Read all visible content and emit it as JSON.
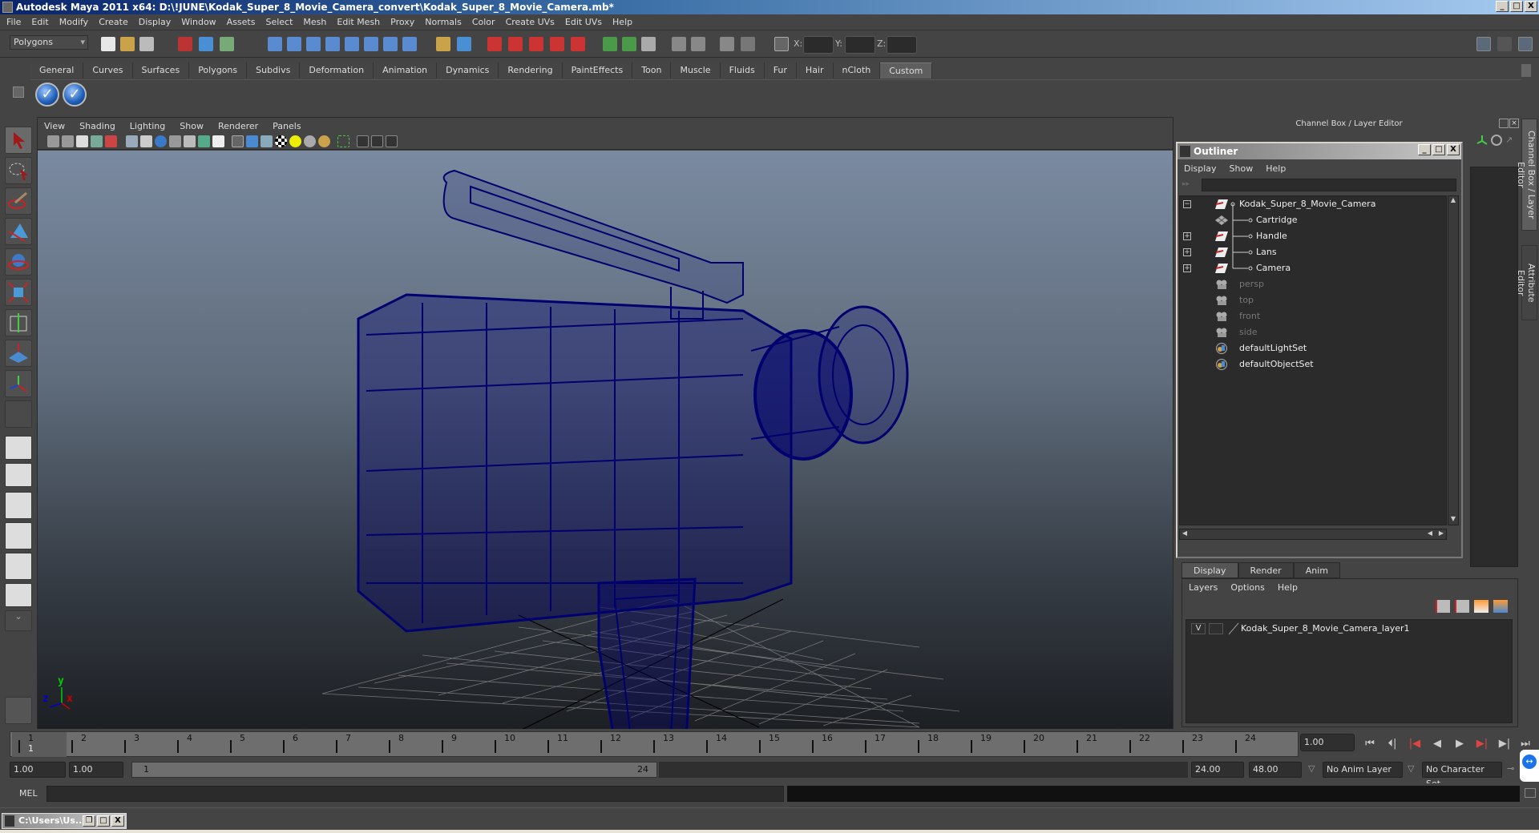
{
  "window": {
    "title": "Autodesk Maya 2011 x64: D:\\!JUNE\\Kodak_Super_8_Movie_Camera_convert\\Kodak_Super_8_Movie_Camera.mb*",
    "minimize": "_",
    "maximize": "□",
    "close": "X"
  },
  "menubar": [
    "File",
    "Edit",
    "Modify",
    "Create",
    "Display",
    "Window",
    "Assets",
    "Select",
    "Mesh",
    "Edit Mesh",
    "Proxy",
    "Normals",
    "Color",
    "Create UVs",
    "Edit UVs",
    "Help"
  ],
  "statusline": {
    "mode_selector": "Polygons",
    "x_label": "X:",
    "y_label": "Y:",
    "z_label": "Z:",
    "x_value": "",
    "y_value": "",
    "z_value": ""
  },
  "shelf": {
    "tabs": [
      "General",
      "Curves",
      "Surfaces",
      "Polygons",
      "Subdivs",
      "Deformation",
      "Animation",
      "Dynamics",
      "Rendering",
      "PaintEffects",
      "Toon",
      "Muscle",
      "Fluids",
      "Fur",
      "Hair",
      "nCloth",
      "Custom"
    ],
    "active_tab": "Custom",
    "buttons": [
      "checkmark-icon",
      "checkmark-icon"
    ]
  },
  "toolbox": [
    "select-tool",
    "lasso-tool",
    "paint-select-tool",
    "move-tool",
    "rotate-tool",
    "scale-tool",
    "universal-manipulator",
    "soft-mod-tool",
    "show-manipulator",
    "last-tool",
    "single-perspective-layout",
    "four-view-layout",
    "outliner-persp-layout",
    "persp-graph-layout",
    "hypershade-persp-layout",
    "persp-graph-outliner-layout",
    "layout-more",
    "maya-logo"
  ],
  "viewport": {
    "menu": [
      "View",
      "Shading",
      "Lighting",
      "Show",
      "Renderer",
      "Panels"
    ],
    "axis": {
      "x": "x",
      "y": "y",
      "z": "z"
    },
    "wireframe_color": "#00006e"
  },
  "channel_box": {
    "header": "Channel Box / Layer Editor"
  },
  "outliner": {
    "title": "Outliner",
    "menu": [
      "Display",
      "Show",
      "Help"
    ],
    "items": [
      {
        "label": "Kodak_Super_8_Movie_Camera",
        "expander": "−",
        "type": "transform",
        "child": false,
        "dim": false
      },
      {
        "label": "Cartridge",
        "expander": "",
        "type": "mesh",
        "child": true,
        "dim": false
      },
      {
        "label": "Handle",
        "expander": "+",
        "type": "transform",
        "child": true,
        "dim": false
      },
      {
        "label": "Lans",
        "expander": "+",
        "type": "transform",
        "child": true,
        "dim": false
      },
      {
        "label": "Camera",
        "expander": "+",
        "type": "transform",
        "child": true,
        "dim": false
      },
      {
        "label": "persp",
        "expander": "",
        "type": "camera",
        "child": false,
        "dim": true
      },
      {
        "label": "top",
        "expander": "",
        "type": "camera",
        "child": false,
        "dim": true
      },
      {
        "label": "front",
        "expander": "",
        "type": "camera",
        "child": false,
        "dim": true
      },
      {
        "label": "side",
        "expander": "",
        "type": "camera",
        "child": false,
        "dim": true
      },
      {
        "label": "defaultLightSet",
        "expander": "",
        "type": "set",
        "child": false,
        "dim": false
      },
      {
        "label": "defaultObjectSet",
        "expander": "",
        "type": "set",
        "child": false,
        "dim": false
      }
    ]
  },
  "layer_editor": {
    "tabs": [
      "Display",
      "Render",
      "Anim"
    ],
    "active_tab": "Display",
    "menu": [
      "Layers",
      "Options",
      "Help"
    ],
    "layers": [
      {
        "visible": "V",
        "name": "Kodak_Super_8_Movie_Camera_layer1"
      }
    ]
  },
  "side_tabs": [
    "Channel Box / Layer Editor",
    "Attribute Editor"
  ],
  "timeline": {
    "ticks": [
      "1",
      "2",
      "3",
      "4",
      "5",
      "6",
      "7",
      "8",
      "9",
      "10",
      "11",
      "12",
      "13",
      "14",
      "15",
      "16",
      "17",
      "18",
      "19",
      "20",
      "21",
      "22",
      "23",
      "24"
    ],
    "current_frame_marker": "1",
    "current_frame": "1.00",
    "playback_buttons": [
      "go-to-start",
      "step-back-frame",
      "step-back-key",
      "play-backwards",
      "play-forwards",
      "step-forward-key",
      "step-forward-frame",
      "go-to-end"
    ]
  },
  "range": {
    "start_time": "1.00",
    "playback_start": "1.00",
    "slider_start": "1",
    "slider_end": "24",
    "playback_end": "24.00",
    "end_time": "48.00",
    "anim_layer": "No Anim Layer",
    "character_set": "No Character Set"
  },
  "command_line": {
    "label": "MEL",
    "value": ""
  },
  "taskbar": {
    "minimized_window": "C:\\Users\\Us..."
  }
}
